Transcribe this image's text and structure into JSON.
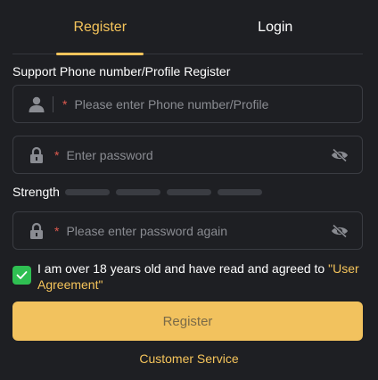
{
  "tabs": [
    {
      "label": "Register",
      "active": true
    },
    {
      "label": "Login",
      "active": false
    }
  ],
  "form": {
    "section_label": "Support Phone number/Profile Register",
    "required_mark": "*",
    "phone_placeholder": "Please enter Phone number/Profile",
    "password_placeholder": "Enter password",
    "confirm_placeholder": "Please enter password again",
    "strength_label": "Strength",
    "strength_levels_filled": 0,
    "agreement_text": "I am over 18 years old and have read and agreed to ",
    "agreement_link": "\"User Agreement\"",
    "agreement_checked": true,
    "register_button": "Register",
    "customer_service": "Customer Service"
  },
  "colors": {
    "background": "#1e1f23",
    "accent": "#f5c45b",
    "button": "#f2c25e",
    "checkbox": "#2fbf52",
    "required": "#e05a4f"
  },
  "icons": {
    "phone_field": "user-icon",
    "password_field": "lock-icon",
    "visibility": "eye-off-icon",
    "checkbox": "check-icon"
  }
}
